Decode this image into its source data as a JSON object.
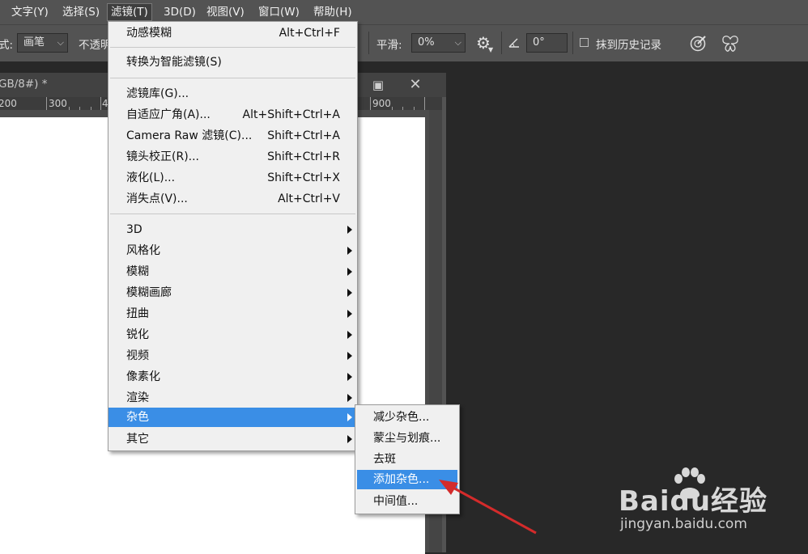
{
  "menubar": {
    "items": [
      "文字(Y)",
      "选择(S)",
      "滤镜(T)",
      "3D(D)",
      "视图(V)",
      "窗口(W)",
      "帮助(H)"
    ],
    "active_index": 2
  },
  "options": {
    "style_label": "式:",
    "brush_value": "画笔",
    "opacity_label": "不透明",
    "smooth_label": "平滑:",
    "smooth_value": "0%",
    "angle_value": "0°",
    "history_label": "抹到历史记录"
  },
  "document": {
    "title": "GB/8#) *",
    "ruler_labels": [
      "200",
      "300",
      "4",
      "900"
    ]
  },
  "filter_menu": {
    "top_items": [
      {
        "label": "动感模糊",
        "shortcut": "Alt+Ctrl+F"
      },
      {
        "label": "转换为智能滤镜(S)",
        "shortcut": ""
      }
    ],
    "gallery_items": [
      {
        "label": "滤镜库(G)...",
        "shortcut": ""
      },
      {
        "label": "自适应广角(A)...",
        "shortcut": "Alt+Shift+Ctrl+A"
      },
      {
        "label": "Camera Raw 滤镜(C)...",
        "shortcut": "Shift+Ctrl+A"
      },
      {
        "label": "镜头校正(R)...",
        "shortcut": "Shift+Ctrl+R"
      },
      {
        "label": "液化(L)...",
        "shortcut": "Shift+Ctrl+X"
      },
      {
        "label": "消失点(V)...",
        "shortcut": "Alt+Ctrl+V"
      }
    ],
    "submenu_items": [
      "3D",
      "风格化",
      "模糊",
      "模糊画廊",
      "扭曲",
      "锐化",
      "视频",
      "像素化",
      "渲染",
      "杂色",
      "其它"
    ],
    "highlighted": "杂色"
  },
  "noise_submenu": {
    "items": [
      "减少杂色...",
      "蒙尘与划痕...",
      "去斑",
      "添加杂色...",
      "中间值..."
    ],
    "highlighted": "添加杂色..."
  },
  "watermark": {
    "brand": "Baidu经验",
    "url": "jingyan.baidu.com"
  },
  "colors": {
    "highlight": "#3a8ee6",
    "annotation_arrow": "#d42b2b"
  }
}
